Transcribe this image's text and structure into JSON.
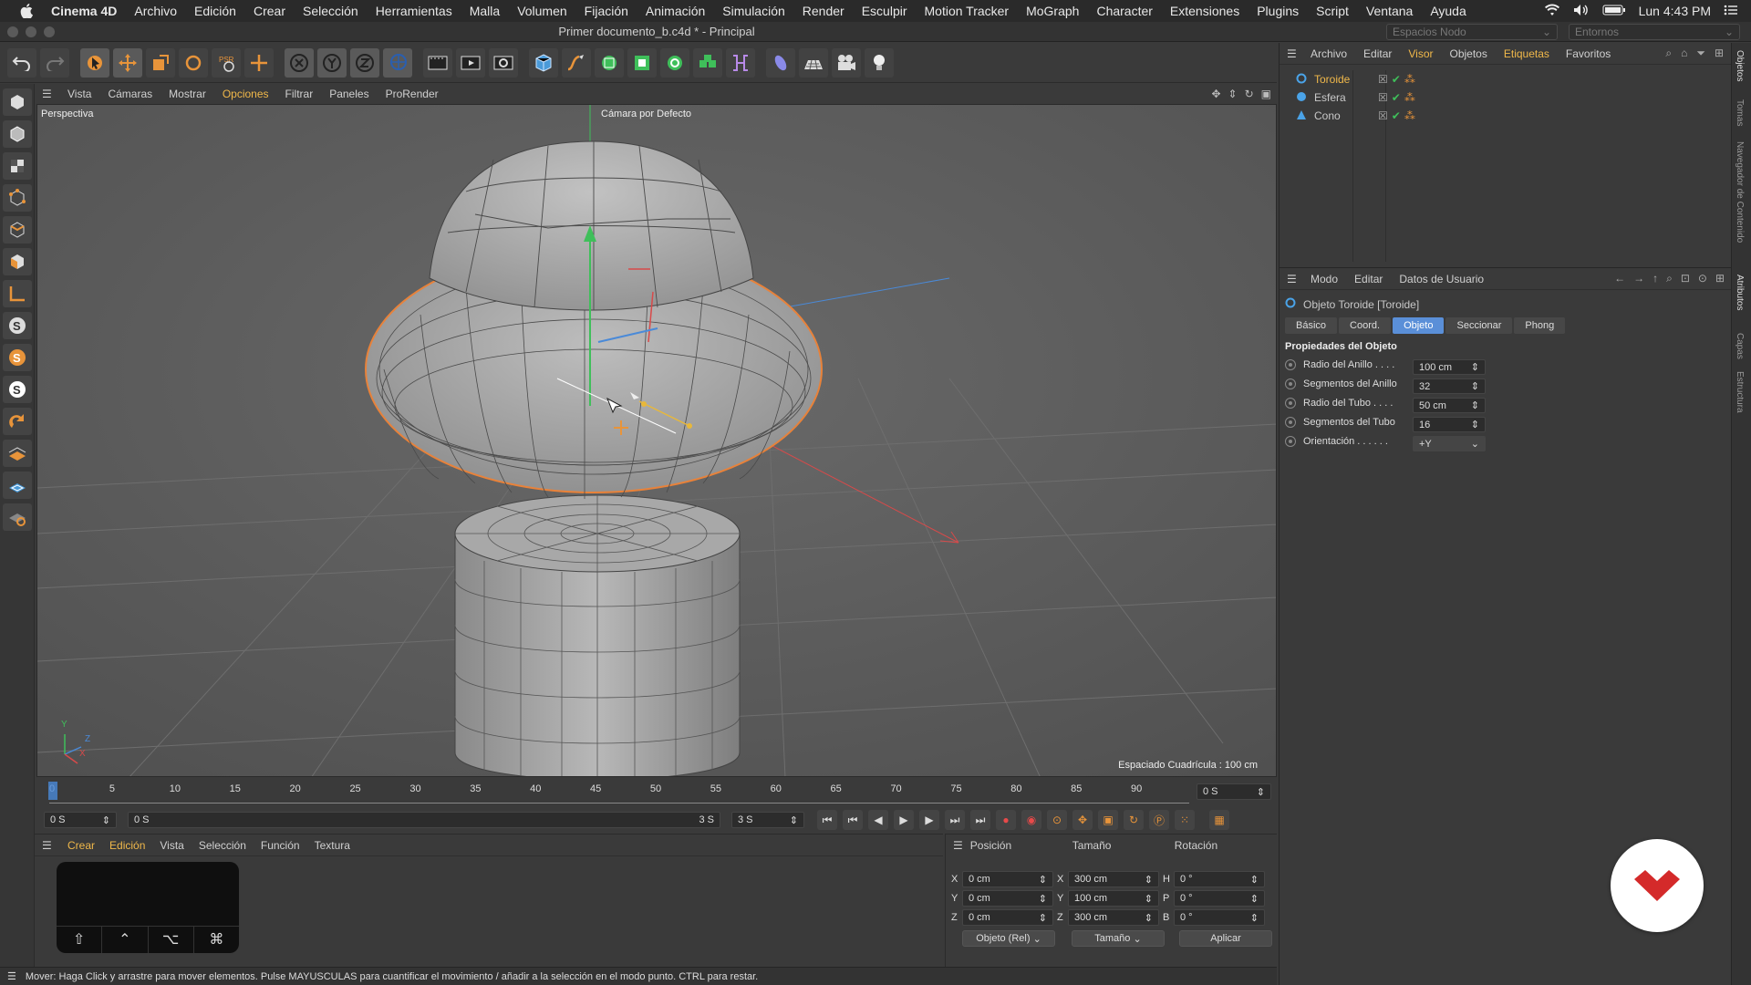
{
  "macbar": {
    "menus": [
      "Cinema 4D",
      "Archivo",
      "Edición",
      "Crear",
      "Selección",
      "Herramientas",
      "Malla",
      "Volumen",
      "Fijación",
      "Animación",
      "Simulación",
      "Render",
      "Esculpir",
      "Motion Tracker",
      "MoGraph",
      "Character",
      "Extensiones",
      "Plugins",
      "Script",
      "Ventana",
      "Ayuda"
    ],
    "clock": "Lun 4:43 PM"
  },
  "window": {
    "title": "Primer documento_b.c4d * - Principal",
    "nodes_select": "Espacios Nodo",
    "env_select": "Entornos"
  },
  "viewport": {
    "menu": [
      "Vista",
      "Cámaras",
      "Mostrar",
      "Opciones",
      "Filtrar",
      "Paneles",
      "ProRender"
    ],
    "active_menu": "Opciones",
    "view_name": "Perspectiva",
    "camera": "Cámara por Defecto",
    "grid_spacing": "Espaciado Cuadrícula : 100 cm",
    "axis_labels": {
      "y": "Y",
      "z": "Z",
      "x": "X"
    }
  },
  "timeline": {
    "ticks": [
      "0",
      "5",
      "10",
      "15",
      "20",
      "25",
      "30",
      "35",
      "40",
      "45",
      "50",
      "55",
      "60",
      "65",
      "70",
      "75",
      "80",
      "85",
      "90"
    ],
    "current_frame": "0 S"
  },
  "playback": {
    "start": "0 S",
    "range_start": "0 S",
    "range_end": "3 S",
    "end": "3 S"
  },
  "material": {
    "menu": [
      "Crear",
      "Edición",
      "Vista",
      "Selección",
      "Función",
      "Textura"
    ],
    "active_menu": [
      "Crear",
      "Edición"
    ],
    "key_symbols": [
      "⇧",
      "⌃",
      "⌥",
      "⌘"
    ]
  },
  "coords": {
    "headers": {
      "position": "Posición",
      "size": "Tamaño",
      "rotation": "Rotación"
    },
    "rows": [
      {
        "axis": "X",
        "pos": "0 cm",
        "size_axis": "X",
        "size": "300 cm",
        "rot_axis": "H",
        "rot": "0 °"
      },
      {
        "axis": "Y",
        "pos": "0 cm",
        "size_axis": "Y",
        "size": "100 cm",
        "rot_axis": "P",
        "rot": "0 °"
      },
      {
        "axis": "Z",
        "pos": "0 cm",
        "size_axis": "Z",
        "size": "300 cm",
        "rot_axis": "B",
        "rot": "0 °"
      }
    ],
    "mode_select": "Objeto (Rel)",
    "size_select": "Tamaño",
    "apply": "Aplicar"
  },
  "status": {
    "text": "Mover: Haga Click y arrastre para mover elementos. Pulse MAYUSCULAS para cuantificar el movimiento / añadir a la selección en el modo punto. CTRL para restar."
  },
  "objects": {
    "menu": [
      "Archivo",
      "Editar",
      "Visor",
      "Objetos",
      "Etiquetas",
      "Favoritos"
    ],
    "active_menu": [
      "Visor",
      "Etiquetas"
    ],
    "items": [
      {
        "name": "Toroide",
        "selected": true,
        "color": "#4aa3e8"
      },
      {
        "name": "Esfera",
        "selected": false,
        "color": "#4aa3e8"
      },
      {
        "name": "Cono",
        "selected": false,
        "color": "#4aa3e8"
      }
    ]
  },
  "attributes": {
    "menu": [
      "Modo",
      "Editar",
      "Datos de Usuario"
    ],
    "object_title": "Objeto Toroide [Toroide]",
    "tabs": [
      "Básico",
      "Coord.",
      "Objeto",
      "Seccionar",
      "Phong"
    ],
    "active_tab": "Objeto",
    "section": "Propiedades del Objeto",
    "props": [
      {
        "label": "Radio del Anillo . . . .",
        "value": "100 cm"
      },
      {
        "label": "Segmentos del Anillo",
        "value": "32"
      },
      {
        "label": "Radio del Tubo . . . .",
        "value": "50 cm"
      },
      {
        "label": "Segmentos del Tubo",
        "value": "16"
      },
      {
        "label": "Orientación . . . . . .",
        "value": "+Y"
      }
    ]
  },
  "side_tabs": [
    "Objetos",
    "Tomas",
    "Navegador de Contenido",
    "Atributos",
    "Capas",
    "Estructura"
  ],
  "colors": {
    "accent": "#f0b84a",
    "selection": "#e8823a",
    "tab_active": "#5a8fd8"
  }
}
